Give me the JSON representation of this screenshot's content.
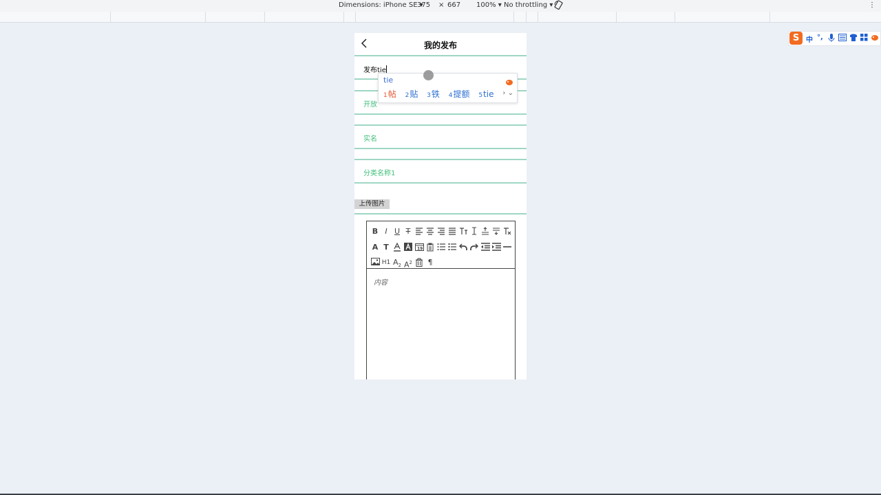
{
  "devtools": {
    "dimensions_label": "Dimensions: iPhone SE",
    "width": "375",
    "times": "×",
    "height": "667",
    "zoom": "100%",
    "throttling": "No throttling",
    "dropdown_glyph": "▾",
    "more_glyph": "⋮"
  },
  "app": {
    "title": "我的发布",
    "back_icon": "chevron-left-icon",
    "title_input_value": "发布tie",
    "fields": {
      "field1": "开放",
      "field2": "实名",
      "field3": "分类名称1"
    },
    "upload_label": "上传图片",
    "editor": {
      "placeholder": "内容",
      "toolbar_glyphs": {
        "bold": "B",
        "italic": "I",
        "underline": "U",
        "strike": "T",
        "font_color": "A",
        "font_size": "T",
        "h1": "H1",
        "subscript": "A",
        "sub_mark": "2",
        "superscript": "A",
        "sup_mark": "2",
        "paragraph": "¶"
      }
    }
  },
  "ime_popup": {
    "pinyin": "tie",
    "candidates": [
      {
        "num": "1",
        "text": "帖"
      },
      {
        "num": "2",
        "text": "贴"
      },
      {
        "num": "3",
        "text": "铁"
      },
      {
        "num": "4",
        "text": "提额"
      },
      {
        "num": "5",
        "text": "tie"
      }
    ],
    "next_glyph": "›",
    "expand_glyph": "⌄"
  },
  "ime_toolbar": {
    "logo": "S",
    "mode": "中",
    "punct": "°,",
    "items": [
      "mic-icon",
      "keyboard-icon",
      "skin-icon",
      "toolbox-icon",
      "mascot-icon"
    ]
  },
  "colors": {
    "page_bg": "#ebf0f6",
    "field_border": "#9ed6c4",
    "field_text": "#3fbf7a",
    "ime_highlight": "#e5532d",
    "ime_candidate": "#2c6fd1",
    "sogou_orange": "#f26b21"
  }
}
